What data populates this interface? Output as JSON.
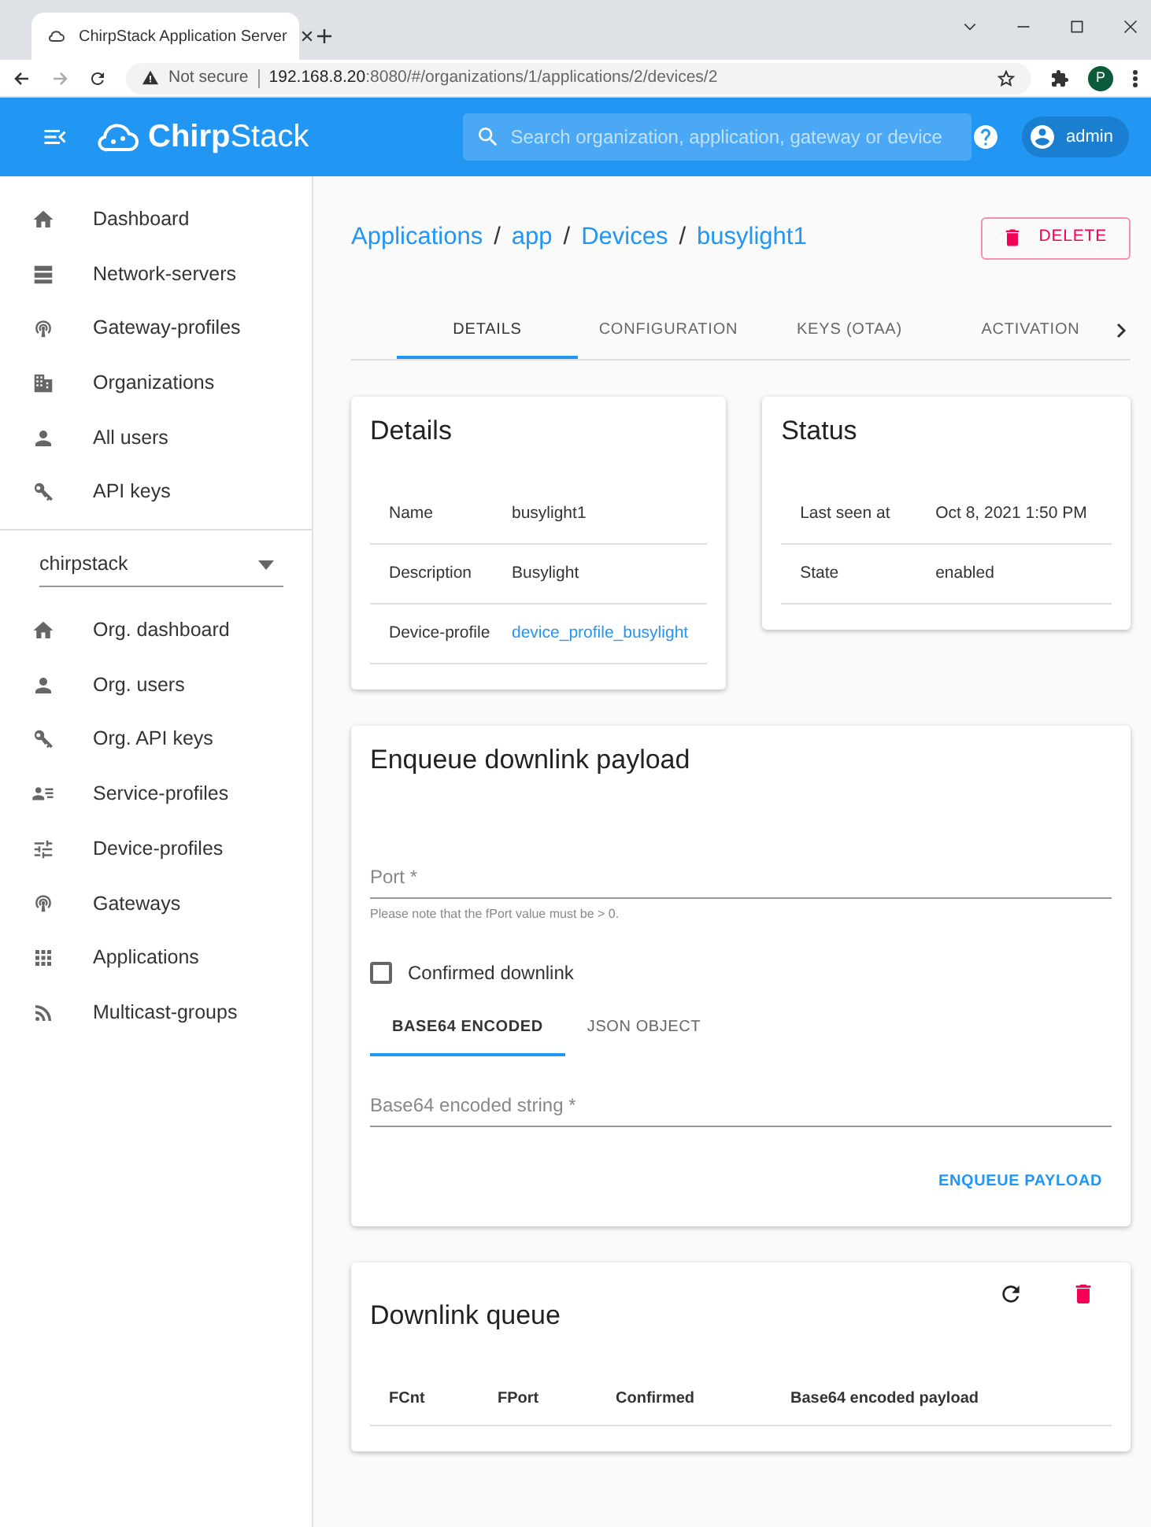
{
  "browser": {
    "tab_title": "ChirpStack Application Server",
    "security": "Not secure",
    "url_host": "192.168.8.20",
    "url_rest": ":8080/#/organizations/1/applications/2/devices/2",
    "profile": "P"
  },
  "appbar": {
    "brand": "**Chirp**Stack",
    "search": {
      "placeholder": "Search organization, application, gateway or device"
    },
    "user": "admin"
  },
  "sidebar": {
    "items": [
      {
        "label": "Dashboard"
      },
      {
        "label": "Network-servers"
      },
      {
        "label": "Gateway-profiles"
      },
      {
        "label": "Organizations"
      },
      {
        "label": "All users"
      },
      {
        "label": "API keys"
      }
    ],
    "org_select": "chirpstack",
    "org_items": [
      {
        "label": "Org. dashboard"
      },
      {
        "label": "Org. users"
      },
      {
        "label": "Org. API keys"
      },
      {
        "label": "Service-profiles"
      },
      {
        "label": "Device-profiles"
      },
      {
        "label": "Gateways"
      },
      {
        "label": "Applications"
      },
      {
        "label": "Multicast-groups"
      }
    ]
  },
  "breadcrumb": [
    {
      "kind": "link",
      "text": "Applications"
    },
    {
      "kind": "separator",
      "text": "/"
    },
    {
      "kind": "link",
      "text": "app"
    },
    {
      "kind": "separator",
      "text": "/"
    },
    {
      "kind": "link",
      "text": "Devices"
    },
    {
      "kind": "separator",
      "text": "/"
    },
    {
      "kind": "link",
      "text": "busylight1"
    }
  ],
  "delete_button": "DELETE",
  "tabs": [
    {
      "label": "DETAILS",
      "selected": true
    },
    {
      "label": "CONFIGURATION",
      "selected": false
    },
    {
      "label": "KEYS (OTAA)",
      "selected": false
    },
    {
      "label": "ACTIVATION",
      "selected": false
    }
  ],
  "details": {
    "title": "Details",
    "rows": [
      {
        "label": "Name",
        "value": "busylight1",
        "kind": "text"
      },
      {
        "label": "Description",
        "value": "Busylight",
        "kind": "text"
      },
      {
        "label": "Device-profile",
        "value": "device_profile_busylight",
        "kind": "link"
      }
    ]
  },
  "status": {
    "title": "Status",
    "rows": [
      {
        "label": "Last seen at",
        "value": "Oct 8, 2021 1:50 PM",
        "kind": "text"
      },
      {
        "label": "State",
        "value": "enabled",
        "kind": "text"
      }
    ]
  },
  "enqueue": {
    "title": "Enqueue downlink payload",
    "port": {
      "placeholder": "Port *",
      "helper": "Please note that the fPort value must be > 0."
    },
    "confirmed": {
      "label": "Confirmed downlink",
      "checked": false
    },
    "tabs": [
      {
        "label": "BASE64 ENCODED",
        "selected": true
      },
      {
        "label": "JSON OBJECT",
        "selected": false
      }
    ],
    "payload": {
      "placeholder": "Base64 encoded string *"
    },
    "button": "ENQUEUE PAYLOAD"
  },
  "queue": {
    "title": "Downlink queue",
    "columns": [
      "FCnt",
      "FPort",
      "Confirmed",
      "Base64 encoded payload"
    ]
  }
}
